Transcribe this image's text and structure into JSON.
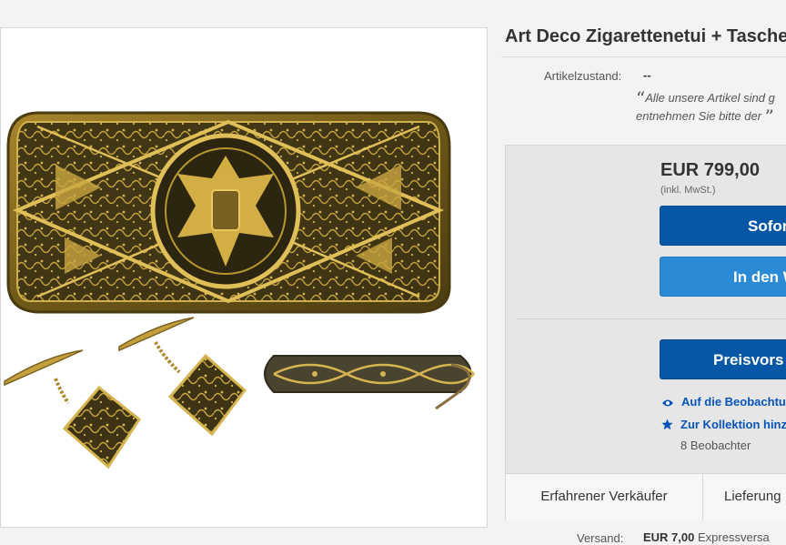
{
  "listing": {
    "title": "Art Deco Zigarettenetui + Tasche",
    "photo_alt": "Zigarettenetui, Manschettenknöpfe und Taschenmesser"
  },
  "condition": {
    "label": "Artikelzustand:",
    "value": "--",
    "quote_line1": "Alle unsere Artikel sind g",
    "quote_line2": "entnehmen Sie bitte der"
  },
  "price": {
    "amount": "EUR 799,00",
    "vat_note": "(inkl. MwSt.)"
  },
  "buttons": {
    "buy_now": "Sofor",
    "add_to_cart": "In den W",
    "make_offer": "Preisvors"
  },
  "actions": {
    "watch": "Auf die Beobachtu",
    "collection": "Zur Kollektion hinz",
    "watchers": "8 Beobachter",
    "watch_icon": "eye-icon",
    "collection_icon": "star-icon"
  },
  "tabs": {
    "seller": "Erfahrener Verkäufer",
    "delivery": "Lieferung"
  },
  "shipping": {
    "label": "Versand:",
    "value": "EUR 7,00",
    "method": "Expressversa"
  },
  "colors": {
    "primary_button": "#0757a6",
    "secondary_button": "#2b8ad6",
    "link": "#0654ba"
  }
}
